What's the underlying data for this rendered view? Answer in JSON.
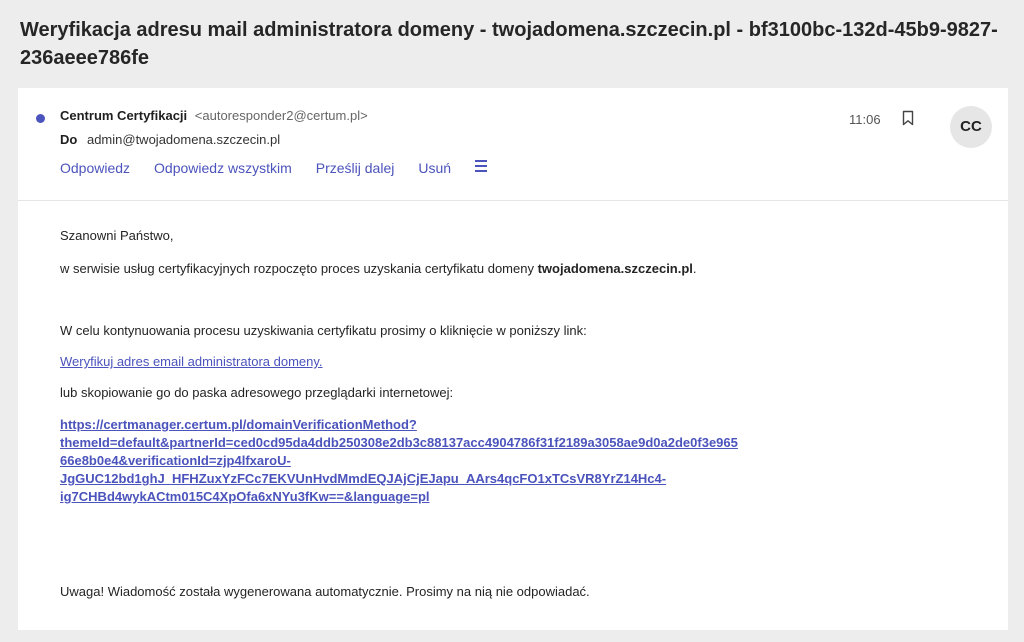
{
  "email": {
    "subject": "Weryfikacja adresu mail administratora domeny - twojadomena.szczecin.pl - bf3100bc-132d-45b9-9827-236aeee786fe",
    "sender_name": "Centrum Certyfikacji",
    "sender_email": "<autoresponder2@certum.pl>",
    "to_label": "Do",
    "to_address": "admin@twojadomena.szczecin.pl",
    "time": "11:06",
    "avatar_initials": "CC"
  },
  "actions": {
    "reply": "Odpowiedz",
    "reply_all": "Odpowiedz wszystkim",
    "forward": "Prześlij dalej",
    "delete": "Usuń"
  },
  "body": {
    "greeting": "Szanowni Państwo,",
    "intro_prefix": "w serwisie usług certyfikacyjnych rozpoczęto proces uzyskania certyfikatu domeny ",
    "domain": "twojadomena.szczecin.pl",
    "intro_suffix": ".",
    "instruction": "W celu kontynuowania procesu uzyskiwania certyfikatu prosimy o kliknięcie w poniższy link:",
    "verify_link": "Weryfikuj adres email administratora domeny.",
    "copy_instruction": "lub skopiowanie go do paska adresowego przeglądarki internetowej:",
    "verification_url": "https://certmanager.certum.pl/domainVerificationMethod?\nthemeId=default&partnerId=ced0cd95da4ddb250308e2db3c88137acc4904786f31f2189a3058ae9d0a2de0f3e965\n66e8b0e4&verificationId=zjp4lfxaroU-\nJgGUC12bd1ghJ_HFHZuxYzFCc7EKVUnHvdMmdEQJAjCjEJapu_AArs4qcFO1xTCsVR8YrZ14Hc4-\nig7CHBd4wykACtm015C4XpOfa6xNYu3fKw==&language=pl",
    "warning": "Uwaga! Wiadomość została wygenerowana automatycznie. Prosimy na nią nie odpowiadać."
  },
  "colors": {
    "accent": "#4b53bc",
    "background": "#ededed",
    "card": "#ffffff"
  },
  "icons": {
    "unread": "unread-dot-icon",
    "bookmark": "bookmark-icon",
    "more": "more-actions-icon"
  }
}
